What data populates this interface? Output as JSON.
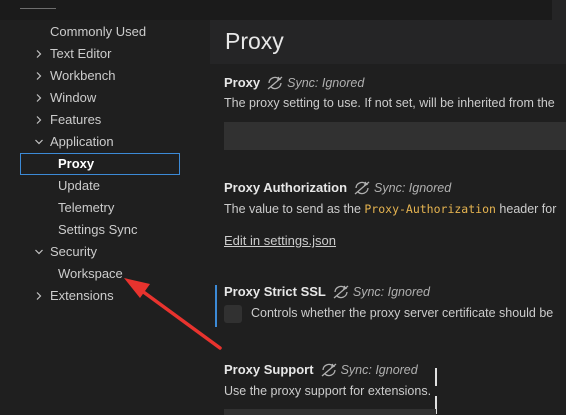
{
  "sidebar": {
    "items": [
      {
        "label": "Commonly Used",
        "chevron": "",
        "indent": 0
      },
      {
        "label": "Text Editor",
        "chevron": "right",
        "indent": 0
      },
      {
        "label": "Workbench",
        "chevron": "right",
        "indent": 0
      },
      {
        "label": "Window",
        "chevron": "right",
        "indent": 0
      },
      {
        "label": "Features",
        "chevron": "right",
        "indent": 0
      },
      {
        "label": "Application",
        "chevron": "down",
        "indent": 0
      },
      {
        "label": "Proxy",
        "chevron": "",
        "indent": 1,
        "selected": true
      },
      {
        "label": "Update",
        "chevron": "",
        "indent": 1
      },
      {
        "label": "Telemetry",
        "chevron": "",
        "indent": 1
      },
      {
        "label": "Settings Sync",
        "chevron": "",
        "indent": 1
      },
      {
        "label": "Security",
        "chevron": "down",
        "indent": 0
      },
      {
        "label": "Workspace",
        "chevron": "",
        "indent": 1
      },
      {
        "label": "Extensions",
        "chevron": "right",
        "indent": 0
      }
    ]
  },
  "main": {
    "title": "Proxy",
    "sync_label": "Sync: Ignored",
    "settings": {
      "proxy": {
        "title": "Proxy",
        "description": "The proxy setting to use. If not set, will be inherited from the",
        "value": ""
      },
      "proxy_authorization": {
        "title": "Proxy Authorization",
        "description_before": "The value to send as the ",
        "description_code": "Proxy-Authorization",
        "description_after": " header for",
        "link": "Edit in settings.json"
      },
      "proxy_strict_ssl": {
        "title": "Proxy Strict SSL",
        "description": "Controls whether the proxy server certificate should be",
        "checked": false
      },
      "proxy_support": {
        "title": "Proxy Support",
        "description": "Use the proxy support for extensions."
      }
    }
  },
  "colors": {
    "background": "#1f1f1f",
    "focus_border": "#3c8ad6",
    "input_bg": "#313131",
    "code": "#e6b450",
    "annotation_arrow": "#e8332e"
  },
  "icons": {
    "sync_ignored": "sync-ignored-icon",
    "chevron_right": "chevron-right-icon",
    "chevron_down": "chevron-down-icon"
  }
}
